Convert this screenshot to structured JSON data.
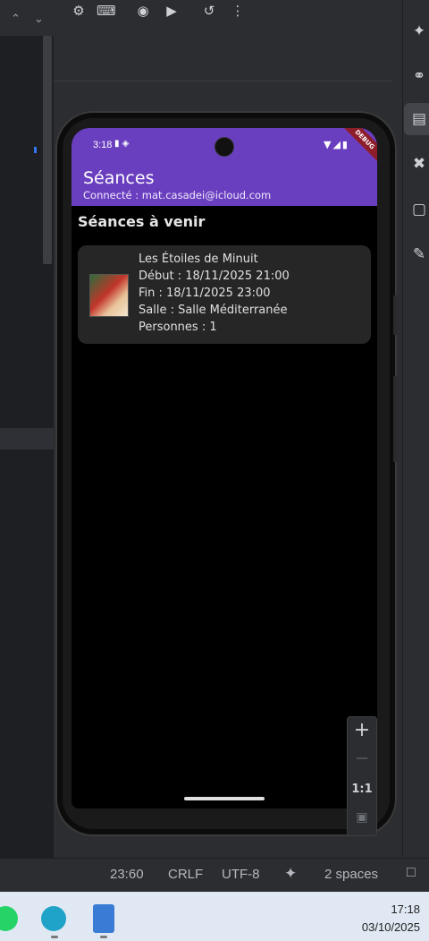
{
  "ide": {
    "toolbar_icons": [
      "device-settings-icon",
      "device-mirror-icon",
      "camera-icon",
      "video-record-icon",
      "rotate-icon",
      "more-vert-icon"
    ],
    "right_strip_icons": [
      "ai-sparkle-icon",
      "link-icon",
      "running-devices-icon",
      "build-tools-icon",
      "app-quality-icon",
      "edit-icon"
    ],
    "left_chevrons": [
      "^",
      "v"
    ]
  },
  "phone": {
    "status_time": "3:18",
    "debug_banner": "DEBUG",
    "app_title": "Séances",
    "connected_text": "Connecté : mat.casadei@icloud.com",
    "section_title": "Séances à venir",
    "session": {
      "title": "Les Étoiles de Minuit",
      "start": "Début : 18/11/2025 21:00",
      "end": "Fin : 18/11/2025 23:00",
      "room": "Salle : Salle Méditerranée",
      "people": "Personnes : 1"
    }
  },
  "zoom": {
    "in": "+",
    "out": "—",
    "reset": "1:1"
  },
  "status_bar": {
    "position": "23:60",
    "line_ending": "CRLF",
    "encoding": "UTF-8",
    "indent": "2 spaces"
  },
  "taskbar": {
    "time": "17:18",
    "date": "03/10/2025",
    "apps": [
      "whatsapp-icon",
      "edge-app-icon",
      "notepad-icon"
    ]
  }
}
